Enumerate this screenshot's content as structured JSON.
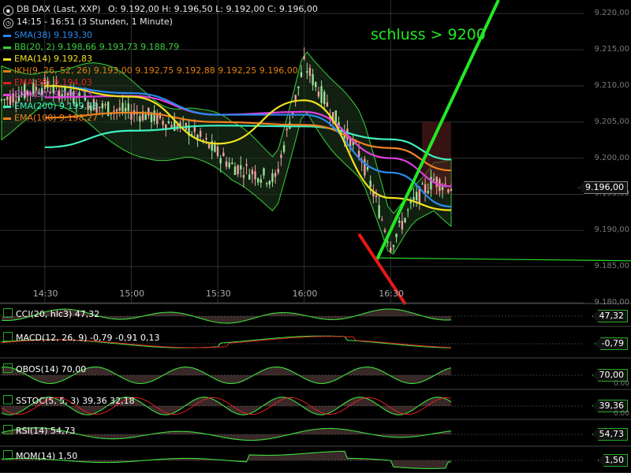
{
  "header": {
    "title": "DB DAX (Last, XXP)",
    "ohlc": "O: 9.192,00  H: 9.196,50  L: 9.192,00  C: 9.196,00",
    "session": "14:15 - 16:51 (3 Stunden, 1 Minute)"
  },
  "annotation": "schluss > 9200",
  "legend": [
    {
      "label": "SMA(38) 9.193,30",
      "color": "#2a8af0"
    },
    {
      "label": "BB(20, 2) 9.198,66 9.193,73 9.188,79",
      "color": "#3ad03a"
    },
    {
      "label": "EMA(14) 9.192,83",
      "color": "#f0e020"
    },
    {
      "label": "IKH(9, 26, 52, 26) 9.193,00 9.192,75 9.192,88 9.192,25 9.196,00",
      "color": "#e08010"
    },
    {
      "label": "EMA(38) 9.194,03",
      "color": "#e02020"
    },
    {
      "label": "EMA(50) 9.196,13",
      "color": "#e040e0"
    },
    {
      "label": "EMA(200) 9.199,78",
      "color": "#40f0c0"
    },
    {
      "label": "EMA(100) 9.198,27",
      "color": "#f08020"
    }
  ],
  "price_axis": [
    "9.220,00",
    "9.215,00",
    "9.210,00",
    "9.205,00",
    "9.200,00",
    "9.195,00",
    "9.190,00",
    "9.185,00",
    "9.180,00"
  ],
  "time_axis": [
    "14:30",
    "15:00",
    "15:30",
    "16:00",
    "16:30"
  ],
  "last_price_tag": "9.196,00",
  "indicators": [
    {
      "label": "CCI(20, hlc3) 47,32",
      "value": "47,32",
      "scale": ""
    },
    {
      "label": "MACD(12, 26, 9) -0,79  -0,91  0,13",
      "value": "-0,79",
      "scale": ""
    },
    {
      "label": "OBOS(14) 70,00",
      "value": "70,00",
      "scale": "0.00"
    },
    {
      "label": "SSTOC(5, 5, 3) 39,36  32,18",
      "value": "39,36",
      "scale": "0.00"
    },
    {
      "label": "RSI(14) 54,73",
      "value": "54,73",
      "scale": ""
    },
    {
      "label": "MOM(14) 1,50",
      "value": "1,50",
      "scale": ""
    }
  ],
  "colors": {
    "bull": "#9ae29a",
    "bear": "#f0a0a0",
    "up_arrow": "#22e822",
    "down_arrow": "#e81818",
    "grid": "#303030",
    "ind_line": "#3ee03e",
    "ind_fill_pos": "#2a8a2a",
    "ind_fill_neg": "#e0a0a0"
  },
  "chart_data": [
    {
      "type": "line",
      "title": "DB DAX (Last, XXP)",
      "xlabel": "",
      "ylabel": "",
      "x": [
        "14:30",
        "15:00",
        "15:30",
        "16:00",
        "16:30",
        "16:51"
      ],
      "ylim": [
        9180,
        9221
      ],
      "series": [
        {
          "name": "EMA(200)",
          "values": [
            9201.5,
            9203.8,
            9204.5,
            9204.4,
            9202.6,
            9199.8
          ]
        },
        {
          "name": "EMA(100)",
          "values": [
            9205.6,
            9206.3,
            9205.0,
            9204.6,
            9201.4,
            9198.3
          ]
        },
        {
          "name": "EMA(50)",
          "values": [
            9208.4,
            9208.6,
            9206.0,
            9206.4,
            9200.0,
            9196.1
          ]
        },
        {
          "name": "SMA(38)",
          "values": [
            9210.0,
            9209.0,
            9206.0,
            9206.0,
            9198.0,
            9193.3
          ]
        },
        {
          "name": "EMA(14)",
          "values": [
            9210.0,
            9208.5,
            9202.0,
            9208.0,
            9194.5,
            9192.8
          ]
        }
      ],
      "last": 9196.0,
      "grid": true
    },
    {
      "type": "line",
      "title": "CCI(20, hlc3)",
      "last": 47.32
    },
    {
      "type": "line",
      "title": "MACD(12, 26, 9)",
      "series": [
        {
          "name": "MACD",
          "last": -0.79
        },
        {
          "name": "Signal",
          "last": -0.91
        },
        {
          "name": "Histogram",
          "last": 0.13
        }
      ]
    },
    {
      "type": "line",
      "title": "OBOS(14)",
      "last": 70.0
    },
    {
      "type": "line",
      "title": "SSTOC(5, 5, 3)",
      "series": [
        {
          "name": "%K",
          "last": 39.36
        },
        {
          "name": "%D",
          "last": 32.18
        }
      ]
    },
    {
      "type": "line",
      "title": "RSI(14)",
      "last": 54.73
    },
    {
      "type": "area",
      "title": "MOM(14)",
      "last": 1.5
    }
  ]
}
